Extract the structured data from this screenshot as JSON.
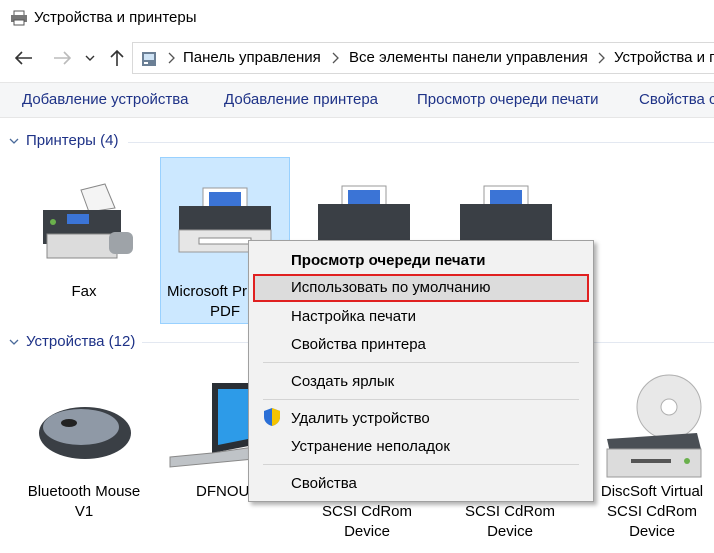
{
  "window": {
    "title": "Устройства и принтеры"
  },
  "nav": {
    "breadcrumbs": [
      "Панель управления",
      "Все элементы панели управления",
      "Устройства и п"
    ]
  },
  "toolbar": {
    "items": [
      "Добавление устройства",
      "Добавление принтера",
      "Просмотр очереди печати",
      "Свойства с"
    ]
  },
  "groups": {
    "printers": {
      "title": "Принтеры (4)",
      "items": [
        {
          "label": "Fax",
          "icon": "fax-icon"
        },
        {
          "label_line1": "Microsoft Pr",
          "label_line2": "PDF",
          "icon": "printer-icon"
        },
        {
          "label": "",
          "icon": "printer-icon"
        },
        {
          "label": "",
          "icon": "printer-icon"
        }
      ]
    },
    "devices": {
      "title": "Устройства (12)",
      "items": [
        {
          "label_line1": "Bluetooth Mouse",
          "label_line2": "V1",
          "icon": "mouse-icon"
        },
        {
          "label": "DFNOUT",
          "icon": "laptop-icon"
        },
        {
          "label_line1": "SCSI CdRom",
          "label_line2": "Device",
          "icon": "drive-icon"
        },
        {
          "label_line1": "SCSI CdRom",
          "label_line2": "Device",
          "icon": "drive-icon"
        },
        {
          "label_line1": "DiscSoft Virtual",
          "label_line2": "SCSI CdRom",
          "label_line3": "Device",
          "icon": "cdrom-icon"
        }
      ]
    }
  },
  "context_menu": {
    "items": [
      {
        "label": "Просмотр очереди печати",
        "bold": true
      },
      {
        "label": "Использовать по умолчанию",
        "highlighted": true
      },
      {
        "label": "Настройка печати"
      },
      {
        "label": "Свойства принтера"
      },
      {
        "label": "Создать ярлык"
      },
      {
        "label": "Удалить устройство",
        "icon": "shield-icon"
      },
      {
        "label": "Устранение неполадок"
      },
      {
        "label": "Свойства"
      }
    ]
  },
  "colors": {
    "link": "#1e3287",
    "selection": "#cce8ff",
    "highlight_border": "#e02020"
  }
}
